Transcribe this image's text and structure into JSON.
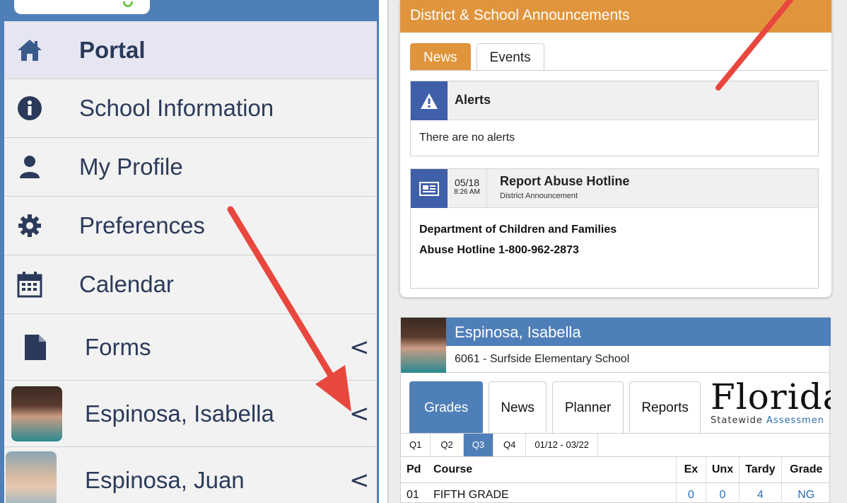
{
  "sidebar": {
    "items": [
      {
        "label": "Portal",
        "icon": "home-icon",
        "active": true
      },
      {
        "label": "School Information",
        "icon": "info-icon"
      },
      {
        "label": "My Profile",
        "icon": "user-icon"
      },
      {
        "label": "Preferences",
        "icon": "gear-icon"
      },
      {
        "label": "Calendar",
        "icon": "calendar-icon"
      },
      {
        "label": "Forms",
        "icon": "document-icon",
        "chevron": "<"
      },
      {
        "label": "Espinosa, Isabella",
        "icon": "avatar",
        "chevron": "<"
      },
      {
        "label": "Espinosa, Juan",
        "icon": "avatar",
        "chevron": "<"
      }
    ]
  },
  "announcements": {
    "title": "District & School Announcements",
    "tabs": [
      "News",
      "Events"
    ],
    "alerts": {
      "title": "Alerts",
      "body": "There are no alerts"
    },
    "hotline": {
      "date": "05/18",
      "time": "8:26 AM",
      "title": "Report Abuse Hotline",
      "subtitle": "District Announcement",
      "line1": "Department of Children and Families",
      "line2": "Abuse Hotline 1-800-962-2873"
    }
  },
  "student": {
    "name": "Espinosa, Isabella",
    "school": "6061 - Surfside Elementary School",
    "tabs": [
      "Grades",
      "News",
      "Planner",
      "Reports"
    ],
    "logo": {
      "big": "Florida",
      "small_prefix": "Statewide ",
      "small_accent": "Assessmen"
    },
    "quarters": [
      "Q1",
      "Q2",
      "Q3",
      "Q4"
    ],
    "active_quarter": "Q3",
    "date_range": "01/12 - 03/22",
    "grades_table": {
      "headers": [
        "Pd",
        "Course",
        "Ex",
        "Unx",
        "Tardy",
        "Grade"
      ],
      "rows": [
        [
          "01",
          "FIFTH GRADE",
          "0",
          "0",
          "4",
          "NG"
        ]
      ]
    }
  },
  "colors": {
    "accent_orange": "#e0953c",
    "accent_blue": "#4f7fb8",
    "icon_navy": "#3f5fa8",
    "arrow_red": "#e8473e"
  }
}
